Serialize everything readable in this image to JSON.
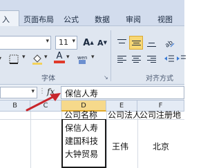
{
  "ribbon": {
    "tabs": [
      "入",
      "页面布局",
      "公式",
      "数据",
      "审阅",
      "视图"
    ],
    "font_group_label": "字体",
    "alignment_group_label": "对齐方式",
    "font_size": "11",
    "font_size_increase": "A",
    "font_size_decrease": "A",
    "font_color_letter": "A",
    "highlight_color": "#f3d25b",
    "font_color": "#e03a2a"
  },
  "formula_bar": {
    "fx_label": "fx",
    "content": "保信人寿",
    "name_box_value": "▾"
  },
  "columns": [
    "B",
    "C",
    "D",
    "E",
    "F"
  ],
  "selected_column": "D",
  "headers": {
    "D": "公司名称",
    "E": "公司法人",
    "F": "公司注册地"
  },
  "cell_d_lines": [
    "保信人寿",
    "建国科技",
    "大钟贸易"
  ],
  "cell_e": "王伟",
  "cell_f": "北京",
  "annotation_color": "#c8262c"
}
